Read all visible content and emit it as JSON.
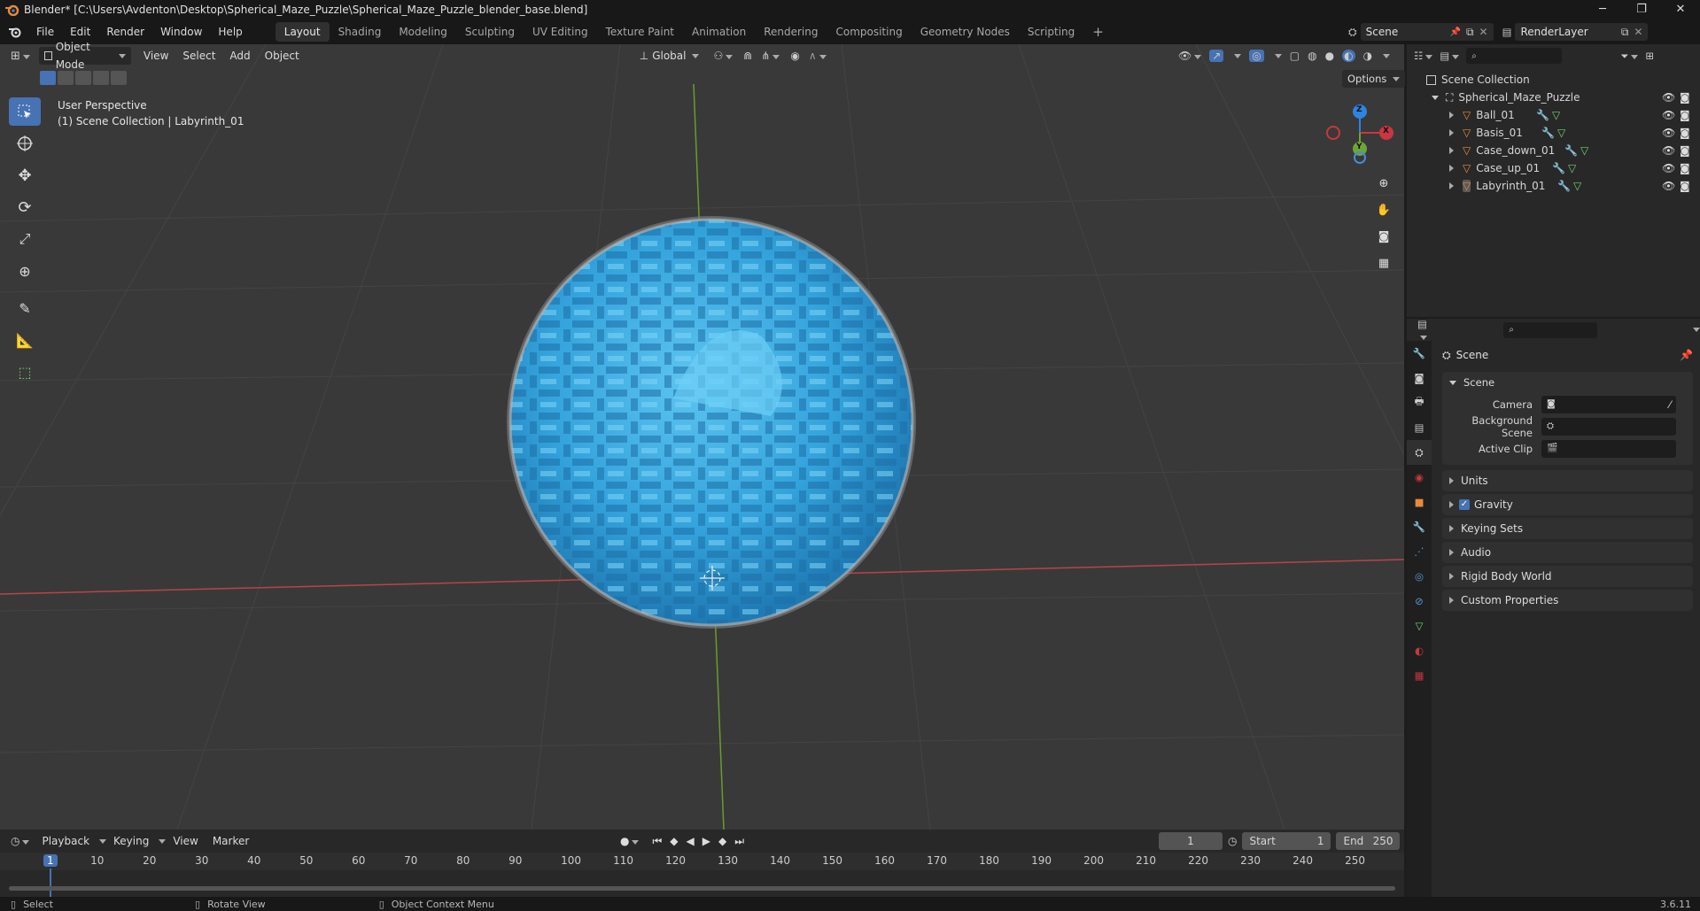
{
  "window": {
    "title": "Blender* [C:\\Users\\Avdenton\\Desktop\\Spherical_Maze_Puzzle\\Spherical_Maze_Puzzle_blender_base.blend]",
    "minimize": "─",
    "maximize": "❐",
    "close": "✕"
  },
  "menu": [
    "File",
    "Edit",
    "Render",
    "Window",
    "Help"
  ],
  "workspaces": [
    "Layout",
    "Shading",
    "Modeling",
    "Sculpting",
    "UV Editing",
    "Texture Paint",
    "Animation",
    "Rendering",
    "Compositing",
    "Geometry Nodes",
    "Scripting"
  ],
  "workspace_add": "+",
  "scene_name": "Scene",
  "view_layer": "RenderLayer",
  "viewport_header": {
    "mode": "Object Mode",
    "menus": [
      "View",
      "Select",
      "Add",
      "Object"
    ],
    "orientation": "Global",
    "options": "Options"
  },
  "viewport_info": {
    "line1": "User Perspective",
    "line2": "(1) Scene Collection | Labyrinth_01"
  },
  "gizmo": {
    "z": "Z",
    "x": "X",
    "y": "Y"
  },
  "outliner": {
    "root": "Scene Collection",
    "collection": "Spherical_Maze_Puzzle",
    "objects": [
      "Ball_01",
      "Basis_01",
      "Case_down_01",
      "Case_up_01",
      "Labyrinth_01"
    ]
  },
  "properties": {
    "header": "Scene",
    "section": "Scene",
    "fields": [
      {
        "label": "Camera",
        "value": ""
      },
      {
        "label": "Background Scene",
        "value": ""
      },
      {
        "label": "Active Clip",
        "value": ""
      }
    ],
    "panels": [
      "Units",
      "Gravity",
      "Keying Sets",
      "Audio",
      "Rigid Body World",
      "Custom Properties"
    ],
    "gravity_checked": true
  },
  "timeline": {
    "menus": [
      "Playback",
      "Keying",
      "View",
      "Marker"
    ],
    "current_frame": "1",
    "start_label": "Start",
    "start": "1",
    "end_label": "End",
    "end": "250",
    "ticks": [
      "1",
      "10",
      "20",
      "30",
      "40",
      "50",
      "60",
      "70",
      "80",
      "90",
      "100",
      "110",
      "120",
      "130",
      "140",
      "150",
      "160",
      "170",
      "180",
      "190",
      "200",
      "210",
      "220",
      "230",
      "240",
      "250"
    ]
  },
  "status": {
    "select": "Select",
    "rotate": "Rotate View",
    "context": "Object Context Menu",
    "version": "3.6.11"
  },
  "colors": {
    "accent": "#4772b3",
    "x_axis": "#c8373f",
    "y_axis": "#6fa534",
    "z_axis": "#2f83e3",
    "maze": "#35a6dd",
    "object_orange": "#e8893c"
  }
}
